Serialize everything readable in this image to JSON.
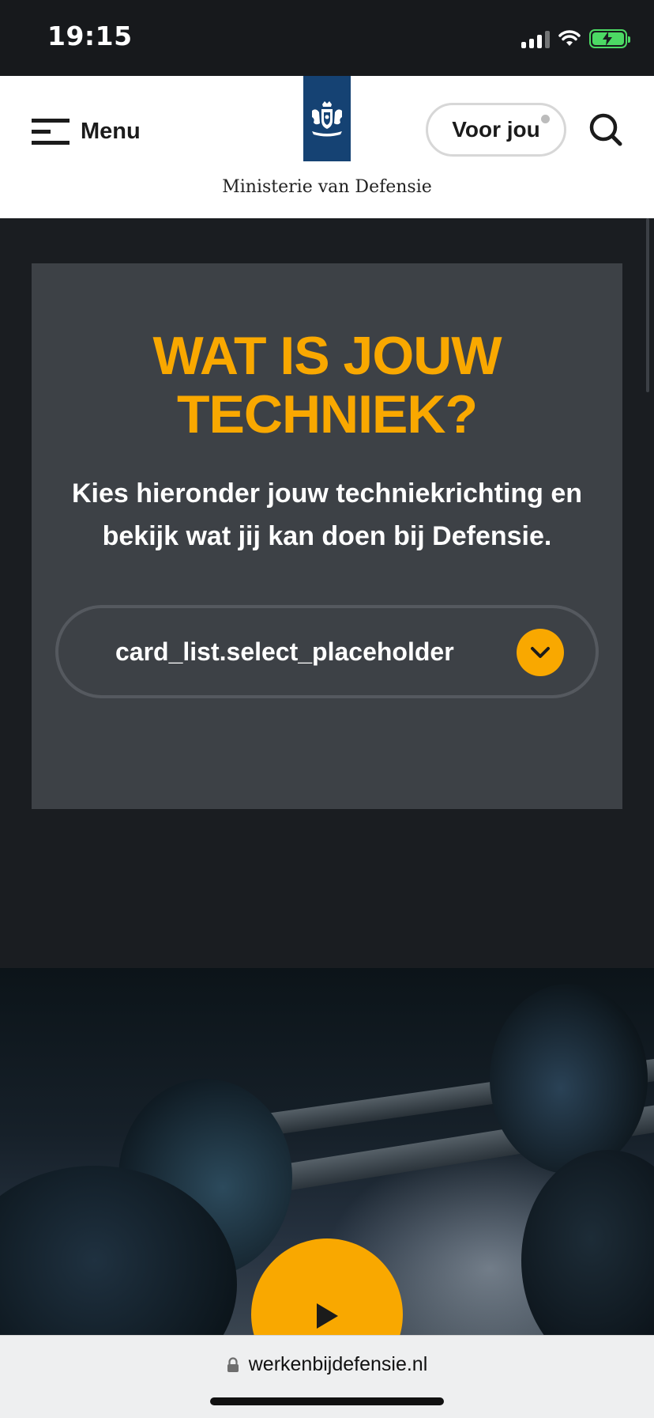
{
  "status_bar": {
    "time": "19:15"
  },
  "header": {
    "menu_label": "Menu",
    "ministry_name": "Ministerie van Defensie",
    "voor_jou_label": "Voor jou"
  },
  "card": {
    "title_line1": "WAT IS JOUW",
    "title_line2": "TECHNIEK?",
    "description_line1": "Kies hieronder jouw techniekrichting en",
    "description_line2": "bekijk wat jij kan doen bij Defensie.",
    "select_value": "card_list.select_placeholder"
  },
  "browser": {
    "url": "werkenbijdefensie.nl"
  },
  "colors": {
    "accent": "#f9a800",
    "logo_blue": "#154273",
    "card_bg": "#3d4146",
    "page_bg": "#1a1d21"
  }
}
